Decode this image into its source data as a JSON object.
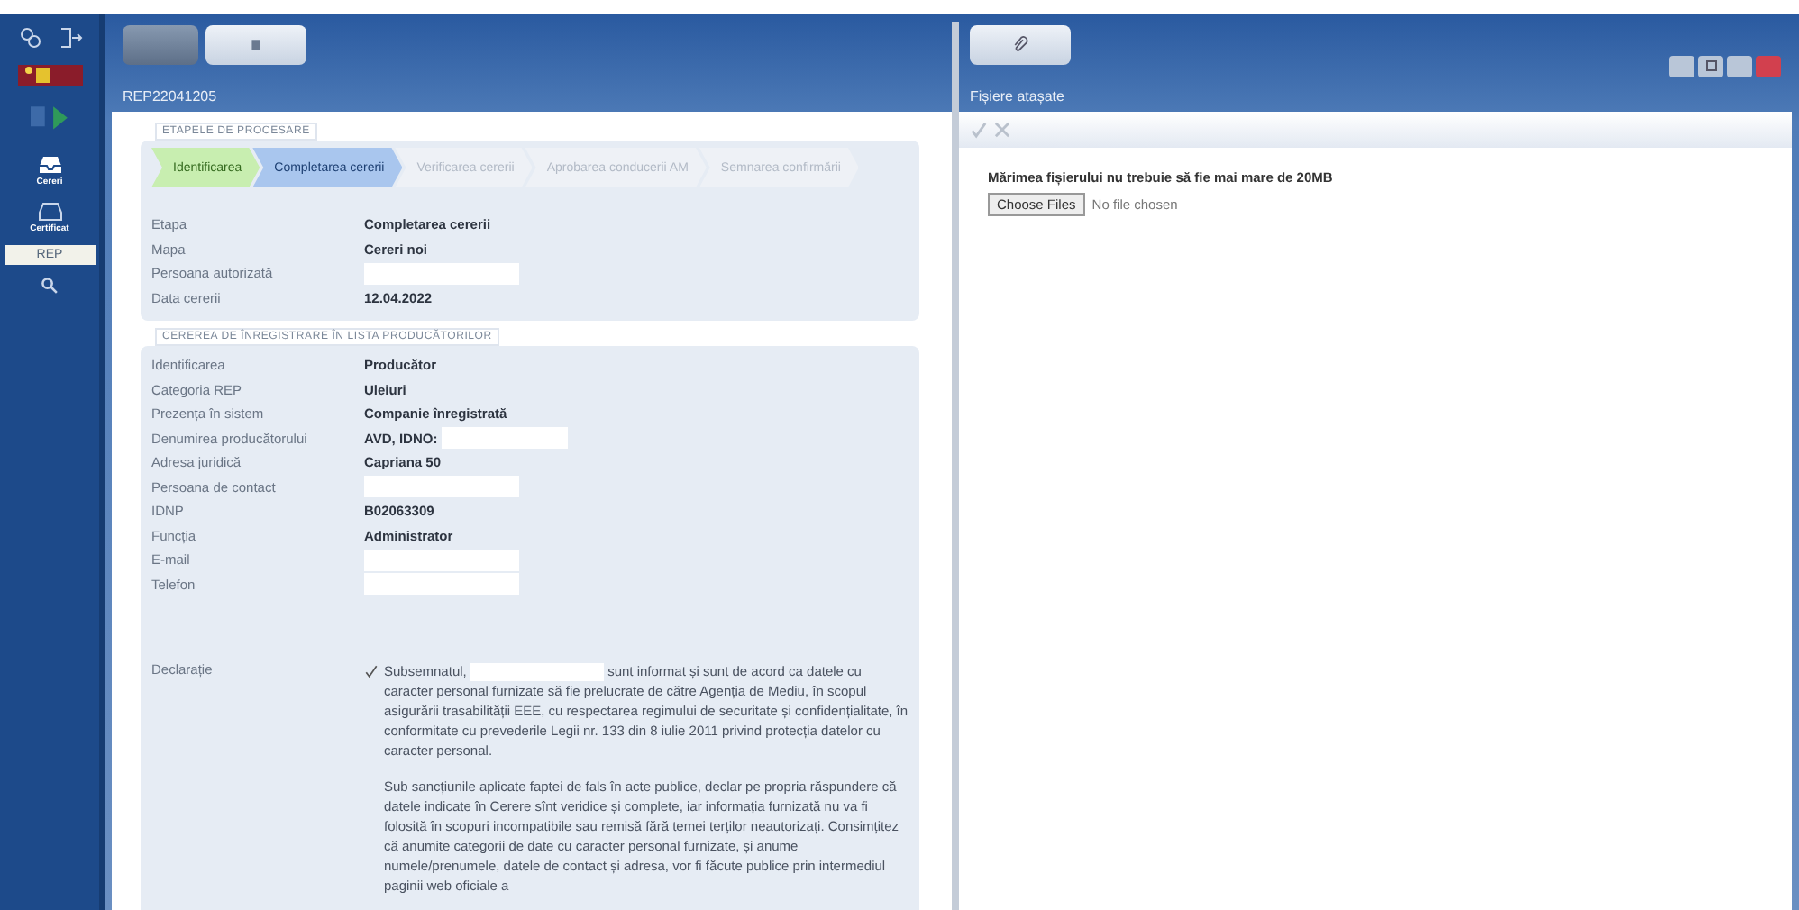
{
  "sidebar": {
    "items": [
      {
        "kind": "cereri",
        "label": "Cereri",
        "selected": false
      },
      {
        "kind": "certificat",
        "label": "Certificat",
        "selected": false
      },
      {
        "kind": "text",
        "label": "REP",
        "selected": true
      },
      {
        "kind": "search",
        "selected": false
      }
    ]
  },
  "left_window": {
    "title": "REP22041205",
    "tabs": [
      {
        "selected": true
      },
      {
        "selected": false
      }
    ],
    "stages": {
      "title": "ETAPELE DE PROCESARE",
      "steps": [
        {
          "label": "Identificarea",
          "completed": true,
          "selected": false
        },
        {
          "label": "Completarea cererii",
          "completed": false,
          "selected": true
        },
        {
          "label": "Verificarea cererii",
          "completed": false,
          "selected": false
        },
        {
          "label": "Aprobarea conducerii AM",
          "completed": false,
          "selected": false
        },
        {
          "label": "Semnarea confirmării",
          "completed": false,
          "selected": false
        }
      ],
      "fields": [
        {
          "label": "Etapa",
          "value": "Completarea cererii"
        },
        {
          "label": "Mapa",
          "value": "Cereri noi"
        },
        {
          "label": "Persoana autorizată",
          "redacted": true
        },
        {
          "label": "Data cererii",
          "value": "12.04.2022"
        }
      ]
    },
    "request": {
      "title": "CEREREA DE ÎNREGISTRARE ÎN LISTA PRODUCĂTORILOR",
      "fields": [
        {
          "label": "Identificarea",
          "value": "Producător"
        },
        {
          "label": "Categoria REP",
          "value": "Uleiuri"
        },
        {
          "label": "Prezența în sistem",
          "value": "Companie înregistrată"
        },
        {
          "label": "Denumirea producătorului",
          "value": "AVD, IDNO:",
          "redacted": true
        },
        {
          "label": "Adresa juridică",
          "value": "Capriana 50"
        },
        {
          "label": "Persoana de contact",
          "redacted": true
        },
        {
          "label": "IDNP",
          "value": "B02063309"
        },
        {
          "label": "Funcția",
          "value": "Administrator"
        },
        {
          "label": "E-mail",
          "redacted": true
        },
        {
          "label": "Telefon",
          "redacted": true
        }
      ],
      "declaration": {
        "label": "Declarație",
        "checked": true,
        "intro": "Subsemnatul,",
        "paragraph_1": "sunt informat și sunt de acord ca datele cu caracter personal furnizate să fie prelucrate de către Agenția de Mediu, în scopul asigurării trasabilității EEE, cu respectarea regimului de securitate și confidențialitate, în conformitate cu prevederile Legii nr. 133 din 8 iulie 2011 privind protecția datelor cu caracter personal.",
        "paragraph_2": "Sub sancțiunile aplicate faptei de fals în acte publice, declar pe propria răspundere că datele indicate în Cerere sînt veridice și complete, iar informația furnizată nu va fi folosită în scopuri incompatibile sau remisă fără temei terților neautorizați. Consimțitez că anumite categorii de date cu caracter personal furnizate, și anume numele/prenumele, datele de contact și adresa, vor fi făcute publice prin intermediul paginii web oficiale a"
      }
    }
  },
  "right_window": {
    "title": "Fișiere atașate",
    "toolbar": [
      {
        "kind": "check",
        "disabled": true
      },
      {
        "kind": "close",
        "disabled": true
      }
    ],
    "note": "Mărimea fișierului nu trebuie să fie mai mare de 20MB",
    "choose_button": "Choose Files",
    "file_status": "No file chosen"
  }
}
